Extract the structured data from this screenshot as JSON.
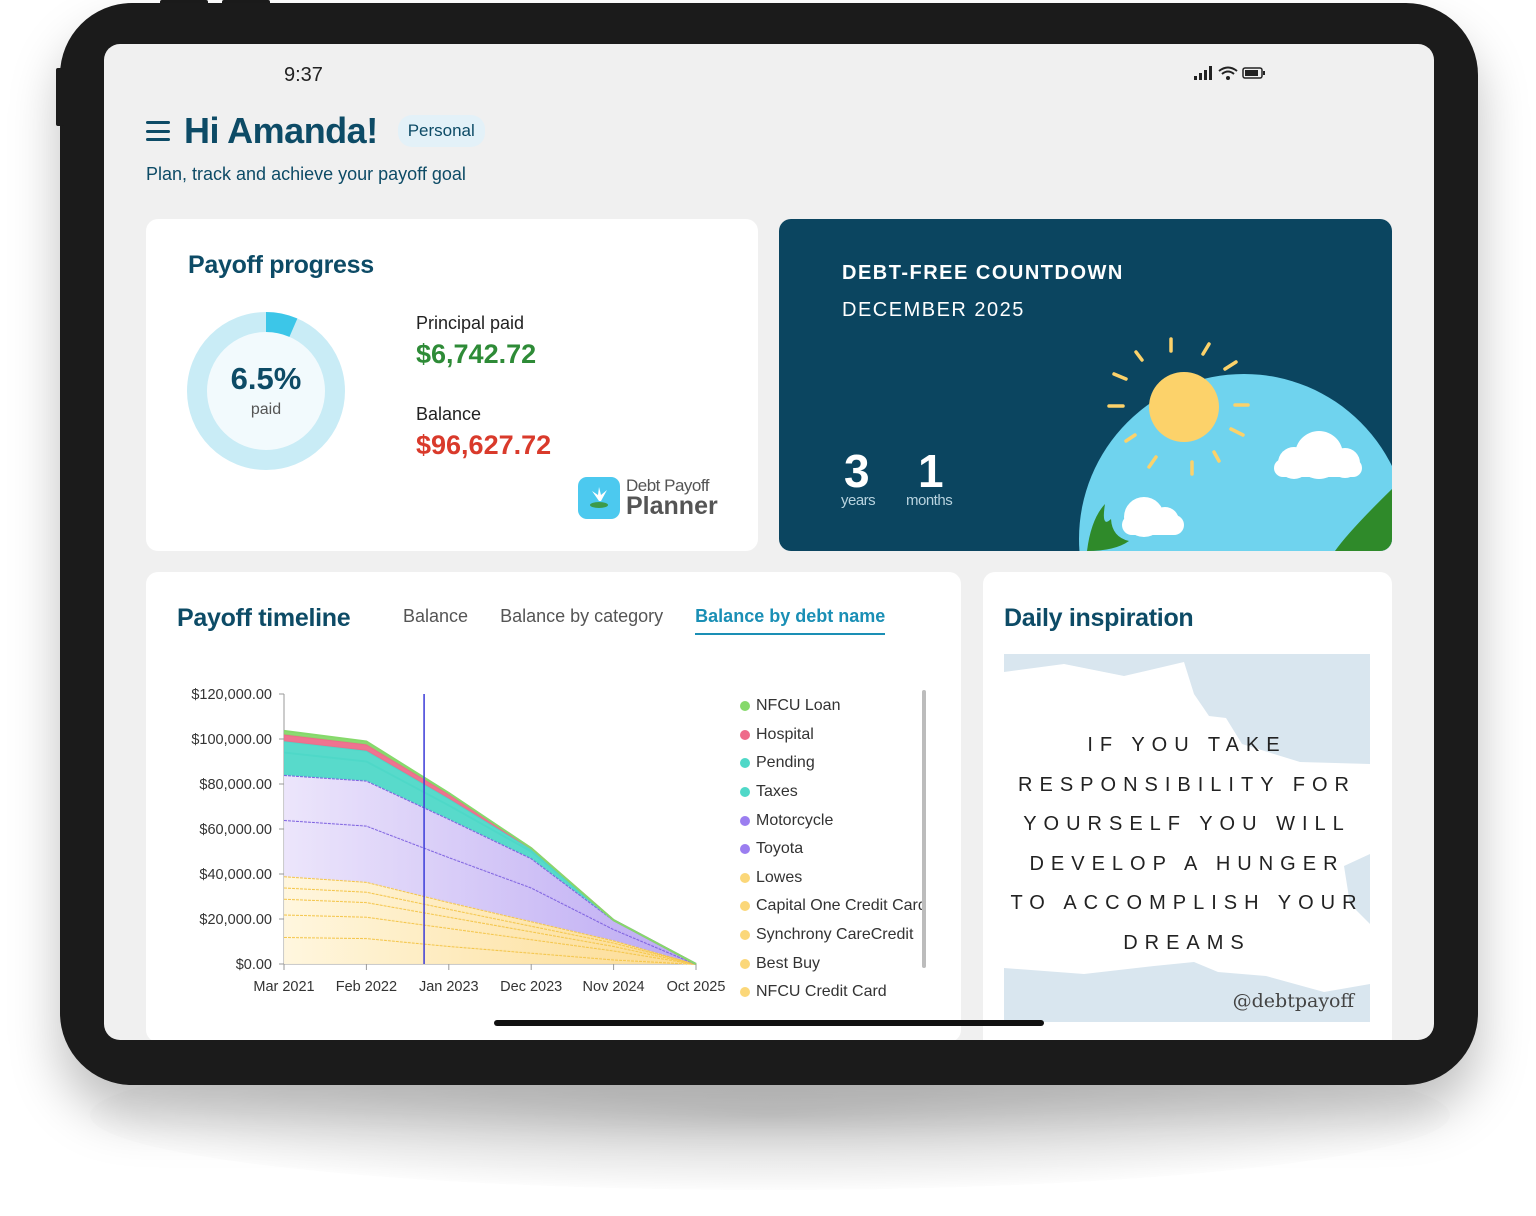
{
  "status_bar": {
    "time": "9:37"
  },
  "header": {
    "greeting": "Hi Amanda!",
    "badge": "Personal",
    "subtitle": "Plan, track and achieve your payoff goal"
  },
  "payoff_progress": {
    "title": "Payoff progress",
    "percent_text": "6.5%",
    "percent_value": 0.065,
    "percent_label": "paid",
    "principal_label": "Principal paid",
    "principal_value": "$6,742.72",
    "balance_label": "Balance",
    "balance_value": "$96,627.72",
    "logo_line1": "Debt Payoff",
    "logo_line2": "Planner"
  },
  "countdown": {
    "heading": "DEBT-FREE COUNTDOWN",
    "date": "DECEMBER 2025",
    "years": "3",
    "years_label": "years",
    "months": "1",
    "months_label": "months"
  },
  "timeline": {
    "title": "Payoff timeline",
    "tabs": [
      "Balance",
      "Balance by category",
      "Balance by debt name"
    ],
    "active_tab": "Balance by debt name"
  },
  "inspiration": {
    "title": "Daily inspiration",
    "quote_lines": [
      "IF YOU TAKE",
      "RESPONSIBILITY FOR",
      "YOURSELF YOU WILL",
      "DEVELOP A HUNGER",
      "TO ACCOMPLISH YOUR",
      "DREAMS"
    ],
    "handle": "@debtpayoff"
  },
  "colors": {
    "primary": "#0d4b66",
    "accent": "#1a8fb5",
    "principal": "#2e8b37",
    "balance": "#d93a2b",
    "ring": "#c9ecf6",
    "ring_fill": "#3cc6e8"
  },
  "chart_data": {
    "type": "area",
    "stacked": true,
    "x_ticks": [
      "Mar 2021",
      "Feb 2022",
      "Jan 2023",
      "Dec 2023",
      "Nov 2024",
      "Oct 2025"
    ],
    "x": [
      "Mar 2021",
      "Feb 2022",
      "Jan 2023",
      "Dec 2023",
      "Nov 2024",
      "Oct 2025"
    ],
    "y_ticks": [
      "$0.00",
      "$20,000.00",
      "$40,000.00",
      "$60,000.00",
      "$80,000.00",
      "$100,000.00",
      "$120,000.00"
    ],
    "ylim": [
      0,
      120000
    ],
    "y_tick_values": [
      0,
      20000,
      40000,
      60000,
      80000,
      100000,
      120000
    ],
    "marker_x": "Oct 2022",
    "series": [
      {
        "name": "NFCU Credit Card",
        "color": "#fbd779",
        "values": [
          12000,
          11500,
          8000,
          5000,
          2000,
          0
        ]
      },
      {
        "name": "Best Buy",
        "color": "#fbd779",
        "values": [
          10000,
          9500,
          8000,
          6000,
          4000,
          0
        ]
      },
      {
        "name": "Synchrony CareCredit",
        "color": "#fbd779",
        "values": [
          7000,
          6500,
          5000,
          3500,
          2000,
          0
        ]
      },
      {
        "name": "Capital One Credit Card",
        "color": "#fbd779",
        "values": [
          5000,
          4600,
          3500,
          2500,
          1500,
          0
        ]
      },
      {
        "name": "Lowes",
        "color": "#fbd779",
        "values": [
          5000,
          4400,
          3000,
          2000,
          1000,
          0
        ]
      },
      {
        "name": "Toyota",
        "color": "#9b7ef0",
        "values": [
          25000,
          25000,
          20000,
          15000,
          5000,
          0
        ]
      },
      {
        "name": "Motorcycle",
        "color": "#9b7ef0",
        "values": [
          20000,
          20000,
          17000,
          13000,
          4000,
          0
        ]
      },
      {
        "name": "Taxes",
        "color": "#4fd8c8",
        "values": [
          10000,
          8500,
          6000,
          3000,
          0,
          0
        ]
      },
      {
        "name": "Pending",
        "color": "#4fd8c8",
        "values": [
          5000,
          4800,
          3000,
          1000,
          0,
          0
        ]
      },
      {
        "name": "Hospital",
        "color": "#ee6b8a",
        "values": [
          3000,
          2800,
          2000,
          500,
          0,
          0
        ]
      },
      {
        "name": "NFCU Loan",
        "color": "#86d96b",
        "values": [
          1600,
          1300,
          500,
          0,
          0,
          0
        ]
      }
    ],
    "legend": [
      "NFCU Loan",
      "Hospital",
      "Pending",
      "Taxes",
      "Motorcycle",
      "Toyota",
      "Lowes",
      "Capital One Credit Card",
      "Synchrony CareCredit",
      "Best Buy",
      "NFCU Credit Card"
    ],
    "legend_colors": [
      "#86d96b",
      "#ee6b8a",
      "#4fd8c8",
      "#4fd8c8",
      "#9b7ef0",
      "#9b7ef0",
      "#fbd779",
      "#fbd779",
      "#fbd779",
      "#fbd779",
      "#fbd779"
    ]
  }
}
